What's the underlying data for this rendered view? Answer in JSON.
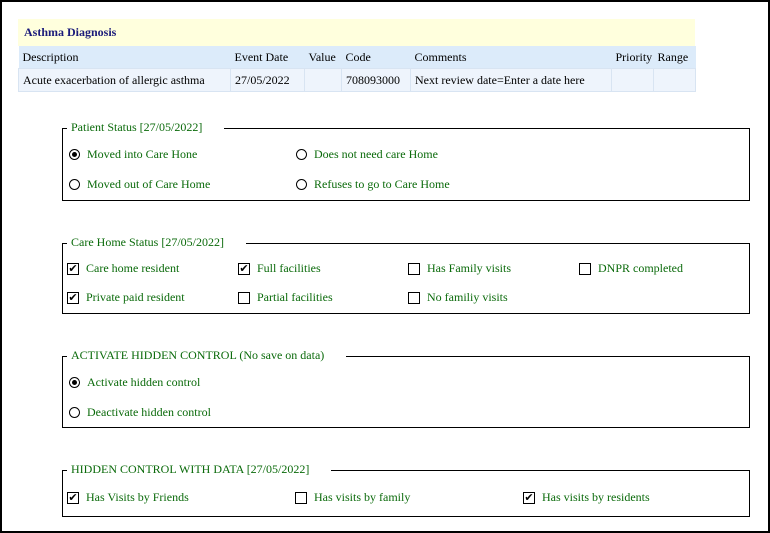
{
  "diagnosis": {
    "title": "Asthma Diagnosis",
    "columns": [
      "Description",
      "Event Date",
      "Value",
      "Code",
      "Comments",
      "Priority",
      "Range"
    ],
    "row": [
      "Acute exacerbation of allergic asthma",
      "27/05/2022",
      "",
      "708093000",
      "Next review date=Enter a date here",
      "",
      ""
    ]
  },
  "patient_status": {
    "legend": "Patient Status [27/05/2022]",
    "options": [
      {
        "label": "Moved into Care Hone",
        "selected": true
      },
      {
        "label": "Does not need care Home",
        "selected": false
      },
      {
        "label": "Moved out of Care Home",
        "selected": false
      },
      {
        "label": "Refuses to go to Care Home",
        "selected": false
      }
    ]
  },
  "care_home_status": {
    "legend": "Care Home Status [27/05/2022]",
    "options": [
      {
        "label": "Care home resident",
        "checked": true
      },
      {
        "label": "Full facilities",
        "checked": true
      },
      {
        "label": "Has Family visits",
        "checked": false
      },
      {
        "label": "DNPR completed",
        "checked": false
      },
      {
        "label": "Private paid resident",
        "checked": true
      },
      {
        "label": "Partial facilities",
        "checked": false
      },
      {
        "label": "No familiy visits",
        "checked": false
      }
    ]
  },
  "hidden_control": {
    "legend": "ACTIVATE HIDDEN CONTROL (No save on data)",
    "options": [
      {
        "label": "Activate hidden control",
        "selected": true
      },
      {
        "label": "Deactivate hidden control",
        "selected": false
      }
    ]
  },
  "hidden_data": {
    "legend": "HIDDEN CONTROL WITH DATA [27/05/2022]",
    "options": [
      {
        "label": "Has Visits by Friends",
        "checked": true
      },
      {
        "label": "Has visits by family",
        "checked": false
      },
      {
        "label": "Has visits by residents",
        "checked": true
      }
    ]
  },
  "check_glyph": "✔"
}
